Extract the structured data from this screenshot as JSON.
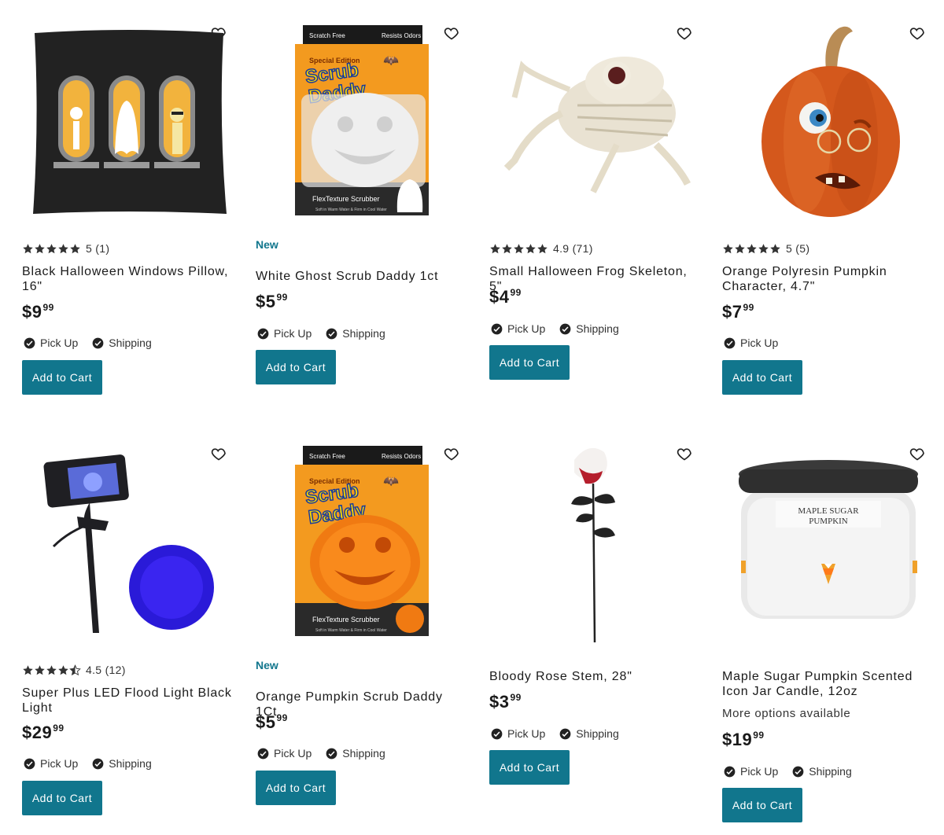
{
  "products": [
    {
      "title": "Black Halloween Windows Pillow, 16\"",
      "rating": "5",
      "reviews": "(1)",
      "stars": 5,
      "badge": "",
      "price_dollars": "$9",
      "price_cents": "99",
      "more": "",
      "pickup": "Pick Up",
      "shipping": "Shipping",
      "button": "Add to Cart"
    },
    {
      "title": "White Ghost Scrub Daddy 1ct",
      "rating": "",
      "reviews": "",
      "stars": 0,
      "badge": "New",
      "price_dollars": "$5",
      "price_cents": "99",
      "more": "",
      "pickup": "Pick Up",
      "shipping": "Shipping",
      "button": "Add to Cart"
    },
    {
      "title": "Small Halloween Frog Skeleton, 5\"",
      "rating": "4.9",
      "reviews": "(71)",
      "stars": 5,
      "badge": "",
      "price_dollars": "$4",
      "price_cents": "99",
      "more": "",
      "pickup": "Pick Up",
      "shipping": "Shipping",
      "button": "Add to Cart"
    },
    {
      "title": "Orange Polyresin Pumpkin Character, 4.7\"",
      "rating": "5",
      "reviews": "(5)",
      "stars": 5,
      "badge": "",
      "price_dollars": "$7",
      "price_cents": "99",
      "more": "",
      "pickup": "Pick Up",
      "shipping": "",
      "button": "Add to Cart"
    },
    {
      "title": "Super Plus LED Flood Light Black Light",
      "rating": "4.5",
      "reviews": "(12)",
      "stars": 4.5,
      "badge": "",
      "price_dollars": "$29",
      "price_cents": "99",
      "more": "",
      "pickup": "Pick Up",
      "shipping": "Shipping",
      "button": "Add to Cart"
    },
    {
      "title": "Orange Pumpkin Scrub Daddy 1Ct",
      "rating": "",
      "reviews": "",
      "stars": 0,
      "badge": "New",
      "price_dollars": "$5",
      "price_cents": "99",
      "more": "",
      "pickup": "Pick Up",
      "shipping": "Shipping",
      "button": "Add to Cart"
    },
    {
      "title": "Bloody Rose Stem, 28\"",
      "rating": "",
      "reviews": "",
      "stars": 0,
      "badge": "",
      "price_dollars": "$3",
      "price_cents": "99",
      "more": "",
      "pickup": "Pick Up",
      "shipping": "Shipping",
      "button": "Add to Cart"
    },
    {
      "title": "Maple Sugar Pumpkin Scented Icon Jar Candle, 12oz",
      "rating": "",
      "reviews": "",
      "stars": 0,
      "badge": "",
      "price_dollars": "$19",
      "price_cents": "99",
      "more": "More options available",
      "pickup": "Pick Up",
      "shipping": "Shipping",
      "button": "Add to Cart"
    }
  ],
  "product_images": {
    "scrub_daddy_top_left": "Scratch Free",
    "scrub_daddy_top_right": "Resists Odors",
    "scrub_daddy_special": "Special Edition",
    "scrub_daddy_brand_1": "Scrub",
    "scrub_daddy_brand_2": "Daddy",
    "scrub_daddy_flex": "FlexTexture Scrubber",
    "scrub_daddy_small": "Soft in Warm Water & Firm in Cool Water",
    "candle_label_1": "MAPLE SUGAR",
    "candle_label_2": "PUMPKIN"
  },
  "colors": {
    "accent": "#11768d",
    "text": "#1a1a1a",
    "badge_new": "#11768d"
  }
}
